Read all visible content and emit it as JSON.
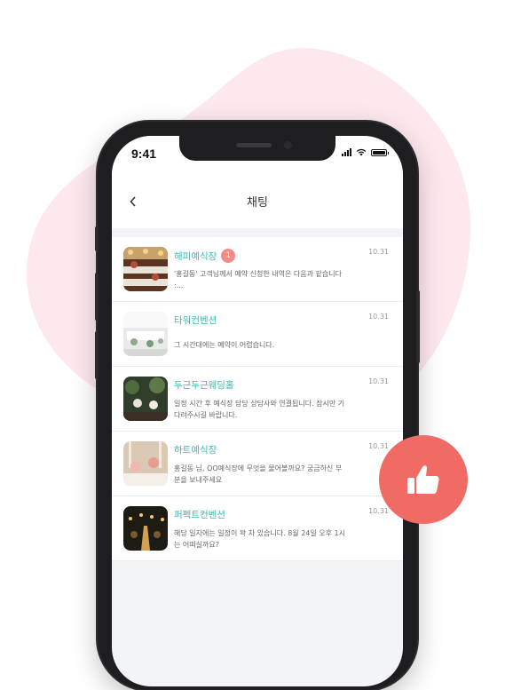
{
  "status_bar": {
    "time": "9:41"
  },
  "header": {
    "title": "채팅"
  },
  "chats": [
    {
      "name": "해피예식장",
      "unread": "1",
      "preview": "'홍길동' 고객님께서 예약 신청한 내역은 다음과 같습니다 :...",
      "date": "10.31",
      "thumb": "banquet-hall-photo"
    },
    {
      "name": "타워컨벤션",
      "unread": "",
      "preview": "그 시간대에는 예약이 어렵습니다.",
      "date": "10.31",
      "thumb": "white-hall-photo"
    },
    {
      "name": "두근두근웨딩홀",
      "unread": "",
      "preview": "일정 시간 후 예식장 담당 상담사와 연결됩니다. 잠시만 기다려주시길 바랍니다.",
      "date": "10.31",
      "thumb": "garden-flowers-photo"
    },
    {
      "name": "하트예식장",
      "unread": "",
      "preview": "홍길동 님, OO예식장에 무엇을 물어볼까요? 궁금하신 부분을 보내주세요",
      "date": "10.31",
      "thumb": "table-setting-photo"
    },
    {
      "name": "퍼펙트컨벤션",
      "unread": "",
      "preview": "해당 일자에는 일정이 꽉 차 있습니다. 8월 24일 오후 1시는 어떠실까요?",
      "date": "10.31",
      "thumb": "night-aisle-photo"
    }
  ],
  "colors": {
    "accent": "#3cb8b0",
    "badge": "#ef8c84",
    "like": "#ef6b64",
    "blob": "#fde8ee"
  },
  "icons": {
    "back": "chevron-left-icon",
    "like": "thumbs-up-icon"
  }
}
